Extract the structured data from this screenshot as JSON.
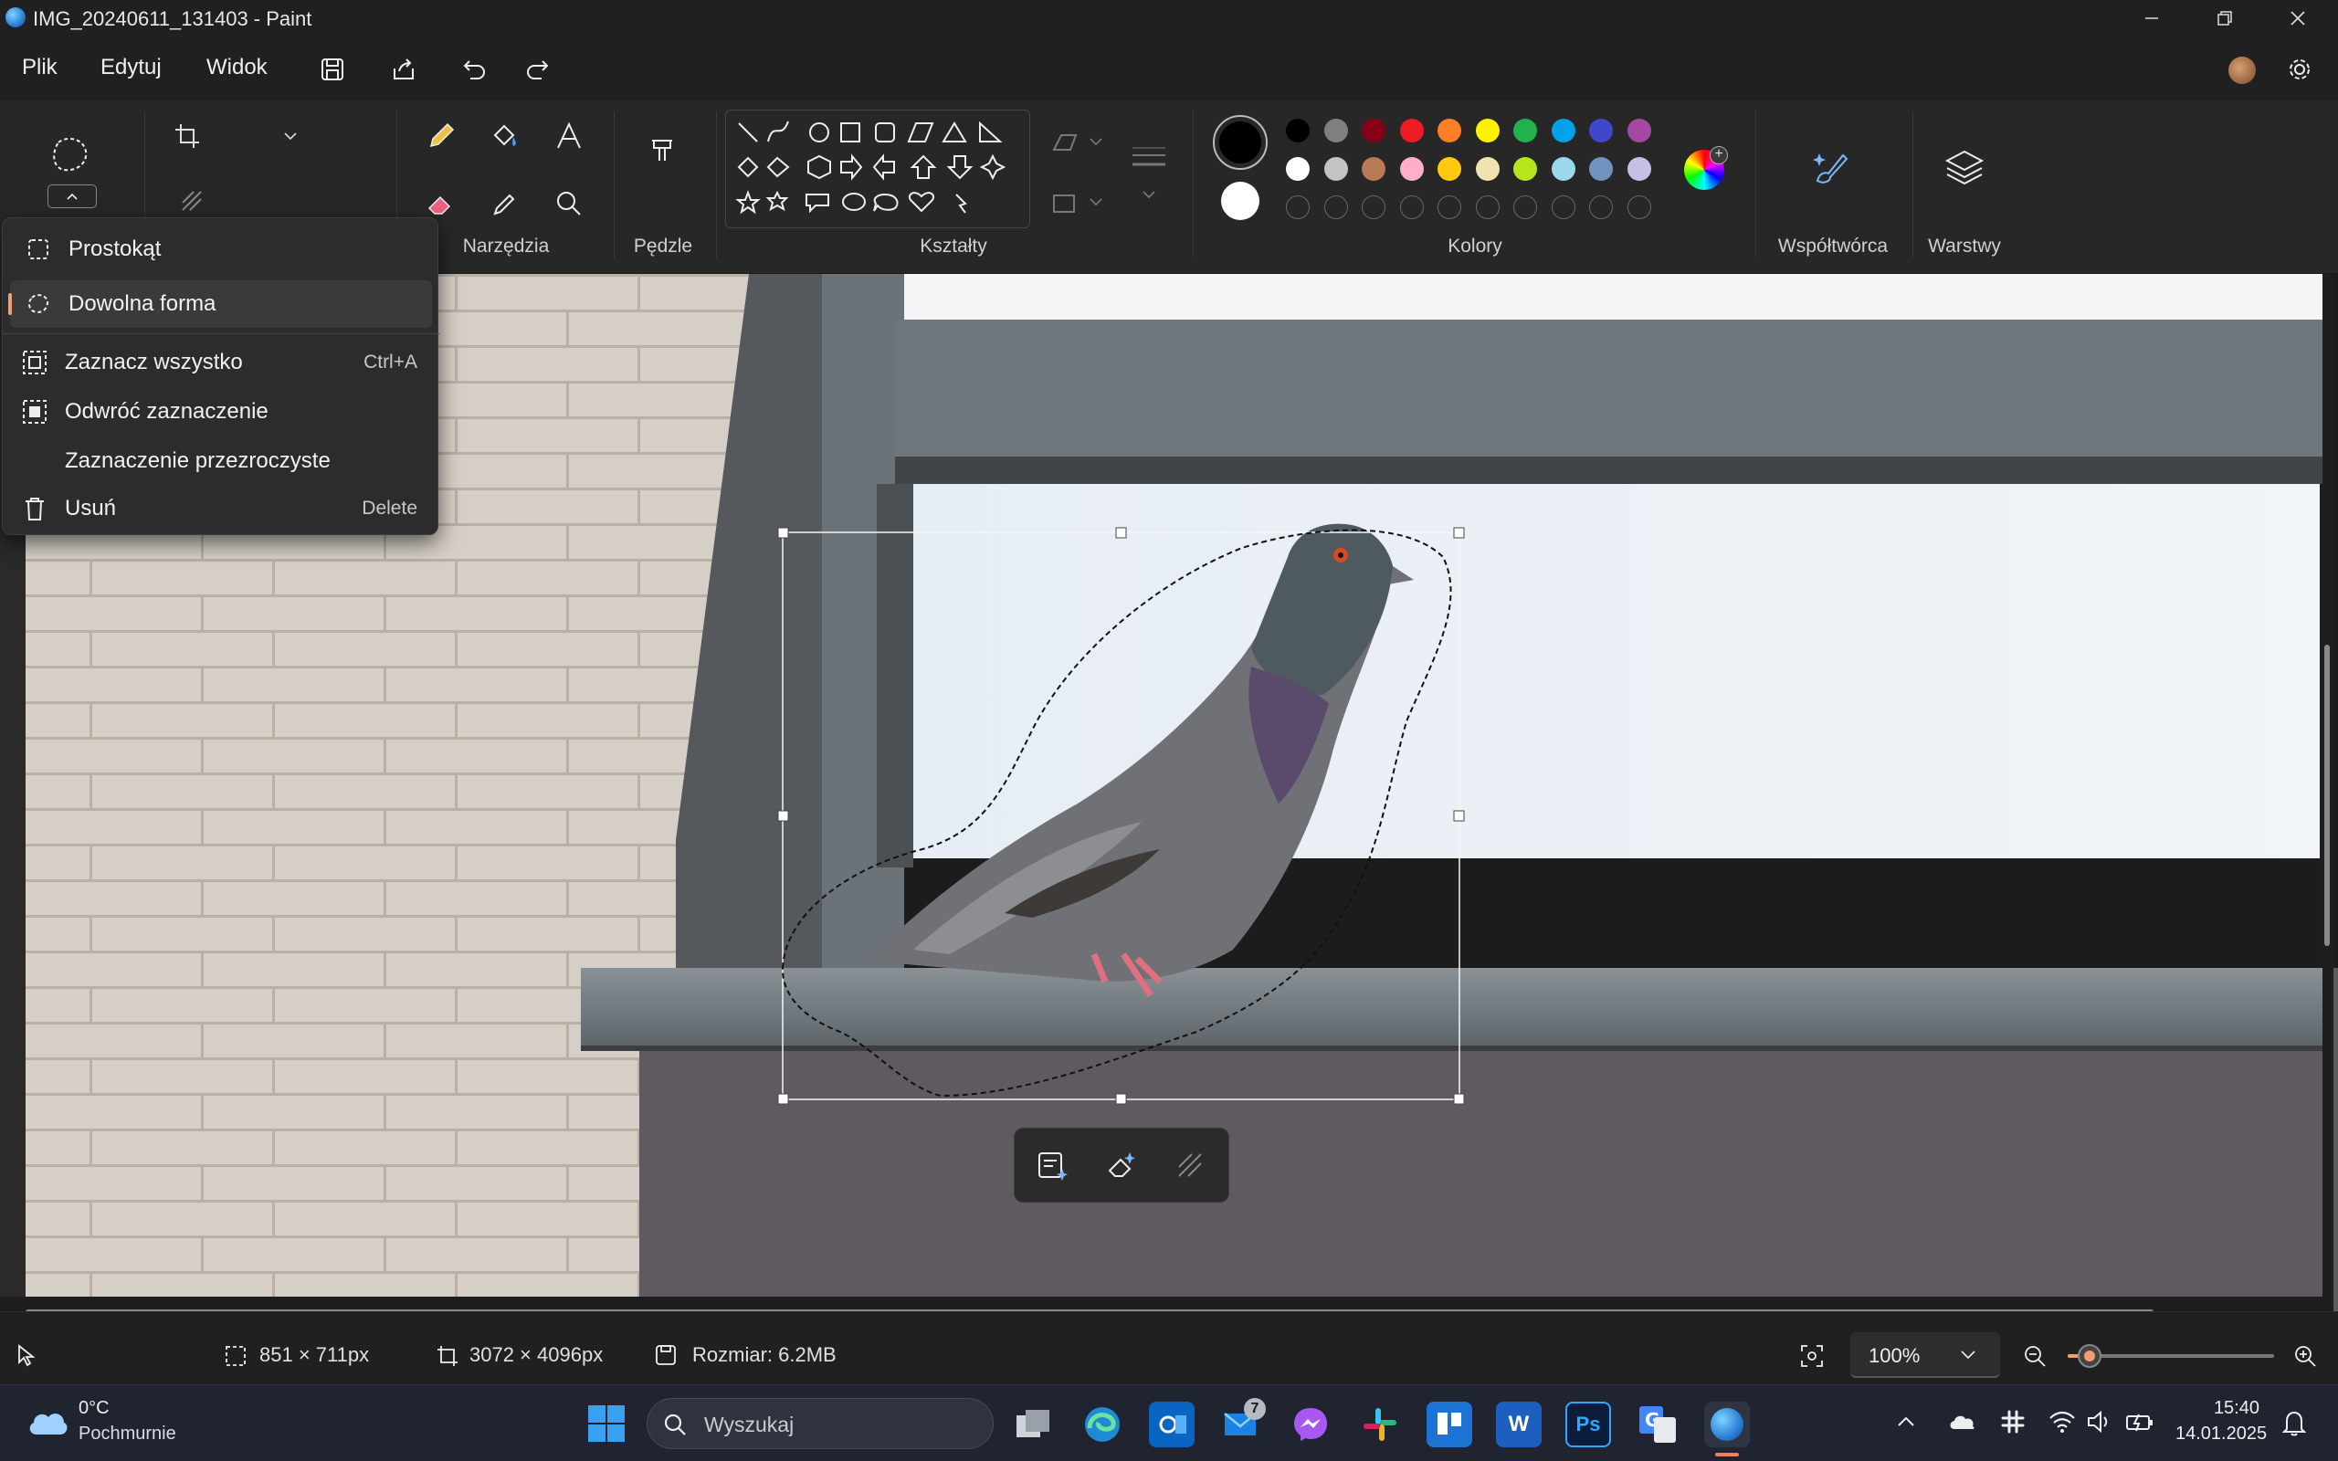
{
  "window": {
    "title": "IMG_20240611_131403 - Paint"
  },
  "menu": {
    "file": "Plik",
    "edit": "Edytuj",
    "view": "Widok"
  },
  "ribbon": {
    "groups": {
      "tools": "Narzędzia",
      "brushes": "Pędzle",
      "shapes": "Kształty",
      "colors": "Kolory",
      "copilot": "Współtwórca",
      "layers": "Warstwy"
    },
    "colors": {
      "primary": "#000000",
      "secondary": "#ffffff",
      "row1": [
        "#000000",
        "#7f7f7f",
        "#880015",
        "#ed1c24",
        "#ff7f27",
        "#fff200",
        "#22b14c",
        "#00a2e8",
        "#3f48cc",
        "#a349a4"
      ],
      "row2": [
        "#ffffff",
        "#c3c3c3",
        "#b97a57",
        "#ffaec9",
        "#ffc90e",
        "#efe4b0",
        "#b5e61d",
        "#99d9ea",
        "#7092be",
        "#c8bfe7"
      ]
    }
  },
  "selection_menu": {
    "items": [
      {
        "label": "Prostokąt",
        "shortcut": ""
      },
      {
        "label": "Dowolna forma",
        "shortcut": ""
      },
      {
        "label": "Zaznacz wszystko",
        "shortcut": "Ctrl+A"
      },
      {
        "label": "Odwróć zaznaczenie",
        "shortcut": ""
      },
      {
        "label": "Zaznaczenie przezroczyste",
        "shortcut": ""
      },
      {
        "label": "Usuń",
        "shortcut": "Delete"
      }
    ]
  },
  "status": {
    "selection_size": "851 × 711px",
    "image_size": "3072 × 4096px",
    "file_size": "Rozmiar: 6.2MB",
    "zoom": "100%",
    "zoom_level": 0.05
  },
  "taskbar": {
    "weather_temp": "0°C",
    "weather_desc": "Pochmurnie",
    "search_placeholder": "Wyszukaj",
    "badge_count": "7",
    "time": "15:40",
    "date": "14.01.2025"
  }
}
